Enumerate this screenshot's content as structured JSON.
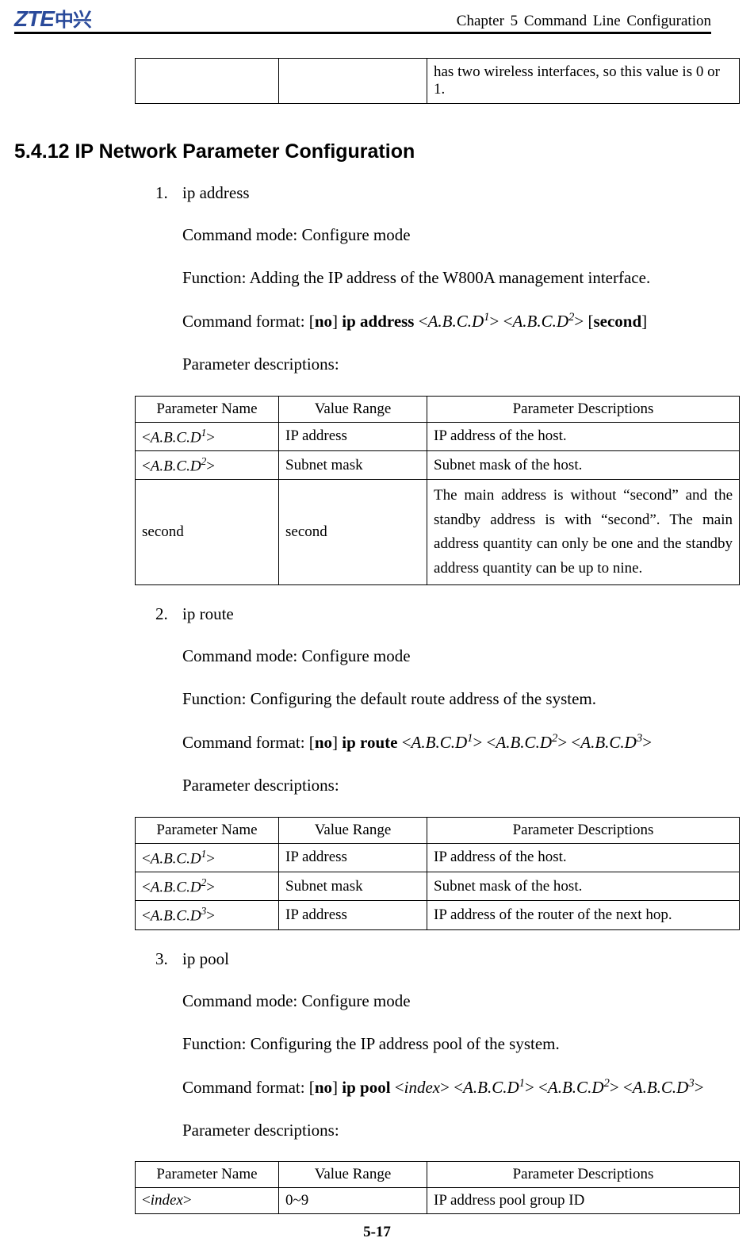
{
  "header": {
    "logo_en": "ZTE",
    "logo_cn": "中兴",
    "chapter": "Chapter 5 Command Line Configuration"
  },
  "fragment": {
    "c1": "",
    "c2": "",
    "c3": "has two wireless interfaces, so this value is 0 or 1."
  },
  "section_title": "5.4.12 IP Network Parameter Configuration",
  "cmd1": {
    "title": "ip address",
    "mode_label": "Command mode: Configure mode",
    "func": "Function: Adding the IP address of the W800A management interface.",
    "fmt_prefix": "Command format: [",
    "fmt_no": "no",
    "fmt_mid1": "] ",
    "fmt_cmd": "ip address",
    "fmt_a1": "A.B.C.D",
    "fmt_s1": "1",
    "fmt_a2": "A.B.C.D",
    "fmt_s2": "2",
    "fmt_second": "second",
    "param_label": "Parameter descriptions:",
    "th1": "Parameter Name",
    "th2": "Value Range",
    "th3": "Parameter Descriptions",
    "rows": [
      {
        "p": "A.B.C.D",
        "sup": "1",
        "range": "IP address",
        "desc": "IP address of the host."
      },
      {
        "p": "A.B.C.D",
        "sup": "2",
        "range": "Subnet mask",
        "desc": "Subnet mask of the host."
      },
      {
        "p_bold": "second",
        "range": "second",
        "desc": "The main address is without “second” and the standby address is with “second”. The main address quantity can only be one and the standby address quantity can be up to nine."
      }
    ]
  },
  "cmd2": {
    "title": "ip route",
    "mode_label": "Command mode: Configure mode",
    "func": "Function: Configuring the default route address of the system.",
    "fmt_cmd": "ip route",
    "fmt_a1": "A.B.C.D",
    "fmt_s1": "1",
    "fmt_a2": "A.B.C.D",
    "fmt_s2": "2",
    "fmt_a3": "A.B.C.D",
    "fmt_s3": "3",
    "param_label": "Parameter descriptions:",
    "rows": [
      {
        "p": "A.B.C.D",
        "sup": "1",
        "range": "IP address",
        "desc": "IP address of the host."
      },
      {
        "p": "A.B.C.D",
        "sup": "2",
        "range": "Subnet mask",
        "desc": "Subnet mask of the host."
      },
      {
        "p": "A.B.C.D",
        "sup": "3",
        "range": "IP address",
        "desc": "IP address of the router of the next hop."
      }
    ]
  },
  "cmd3": {
    "title": "ip pool",
    "mode_label": "Command mode: Configure mode",
    "func": "Function: Configuring the IP address pool of the system.",
    "fmt_cmd": "ip pool",
    "fmt_index": "index",
    "fmt_a1": "A.B.C.D",
    "fmt_s1": "1",
    "fmt_a2": "A.B.C.D",
    "fmt_s2": "2",
    "fmt_a3": "A.B.C.D",
    "fmt_s3": "3",
    "param_label": "Parameter descriptions:",
    "rows": [
      {
        "p_ital": "index",
        "range": "0~9",
        "desc": "IP address pool group ID"
      }
    ]
  },
  "footer": "5-17",
  "table_headers": {
    "th1": "Parameter Name",
    "th2": "Value Range",
    "th3": "Parameter Descriptions"
  }
}
